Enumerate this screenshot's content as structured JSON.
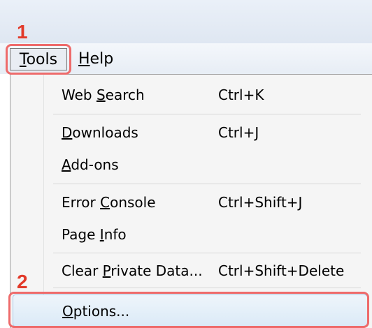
{
  "menubar": {
    "tools": {
      "pre": "",
      "mnemonic": "T",
      "post": "ools"
    },
    "help": {
      "pre": "",
      "mnemonic": "H",
      "post": "elp"
    }
  },
  "annotations": {
    "step1": "1",
    "step2": "2",
    "color": "#e23a2a"
  },
  "tools_menu": [
    {
      "pre": "Web ",
      "mnemonic": "S",
      "post": "earch",
      "shortcut": "Ctrl+K"
    },
    {
      "pre": "",
      "mnemonic": "D",
      "post": "ownloads",
      "shortcut": "Ctrl+J"
    },
    {
      "pre": "",
      "mnemonic": "A",
      "post": "dd-ons",
      "shortcut": ""
    },
    {
      "pre": "Error ",
      "mnemonic": "C",
      "post": "onsole",
      "shortcut": "Ctrl+Shift+J"
    },
    {
      "pre": "Page ",
      "mnemonic": "I",
      "post": "nfo",
      "shortcut": ""
    },
    {
      "pre": "Clear ",
      "mnemonic": "P",
      "post": "rivate Data...",
      "shortcut": "Ctrl+Shift+Delete"
    },
    {
      "pre": "",
      "mnemonic": "O",
      "post": "ptions...",
      "shortcut": ""
    }
  ]
}
